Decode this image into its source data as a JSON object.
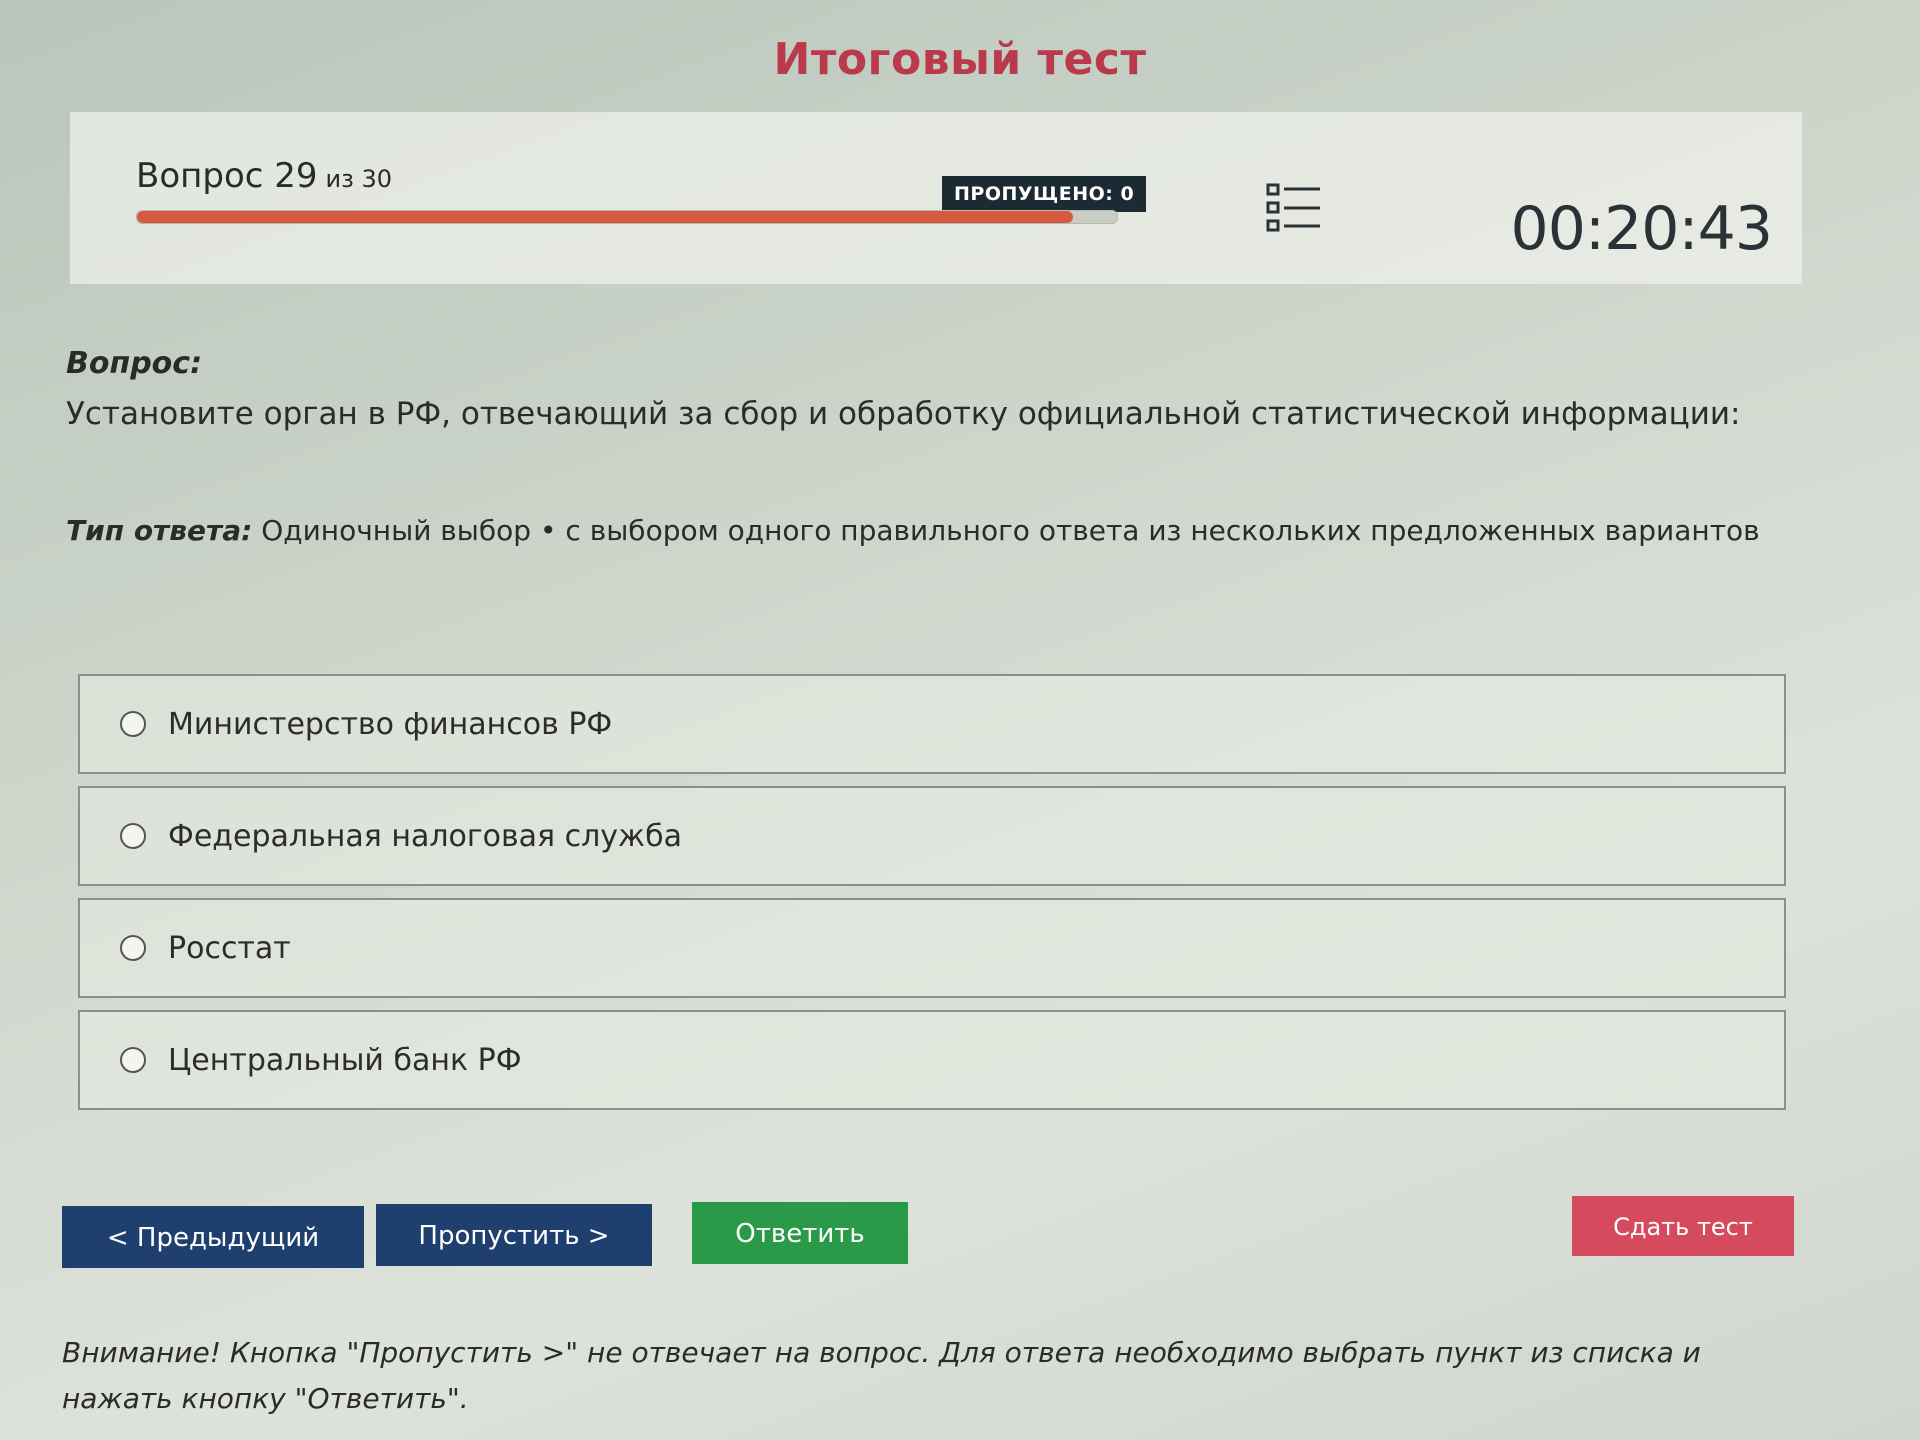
{
  "header": {
    "title": "Итоговый тест"
  },
  "status": {
    "question_prefix": "Вопрос 29",
    "question_total": "из 30",
    "current_question": 29,
    "total_questions": 30,
    "progress_fraction": 0.955,
    "skipped_label": "ПРОПУЩЕНО: 0",
    "timer": "00:20:43",
    "question_list_icon": "list-icon"
  },
  "question": {
    "label": "Вопрос:",
    "text": "Установите орган в РФ, отвечающий за сбор и обработку официальной статистической информации:",
    "answer_type_label": "Тип ответа:",
    "answer_type_value": " Одиночный выбор • с выбором одного правильного ответа из нескольких предложенных вариантов"
  },
  "options": [
    {
      "label": "Министерство финансов РФ"
    },
    {
      "label": "Федеральная налоговая служба"
    },
    {
      "label": "Росстат"
    },
    {
      "label": "Центральный банк РФ"
    }
  ],
  "buttons": {
    "prev": "< Предыдущий",
    "skip": "Пропустить >",
    "answer": "Ответить",
    "submit": "Сдать тест"
  },
  "warning": "Внимание! Кнопка \"Пропустить >\" не отвечает на вопрос. Для ответа необходимо выбрать пункт из списка и нажать кнопку \"Ответить\".",
  "colors": {
    "title": "#b83a4b",
    "progress": "#d65a40",
    "nav_button": "#1f3f6e",
    "answer_button": "#2b9a48",
    "submit_button": "#d64a5e"
  }
}
